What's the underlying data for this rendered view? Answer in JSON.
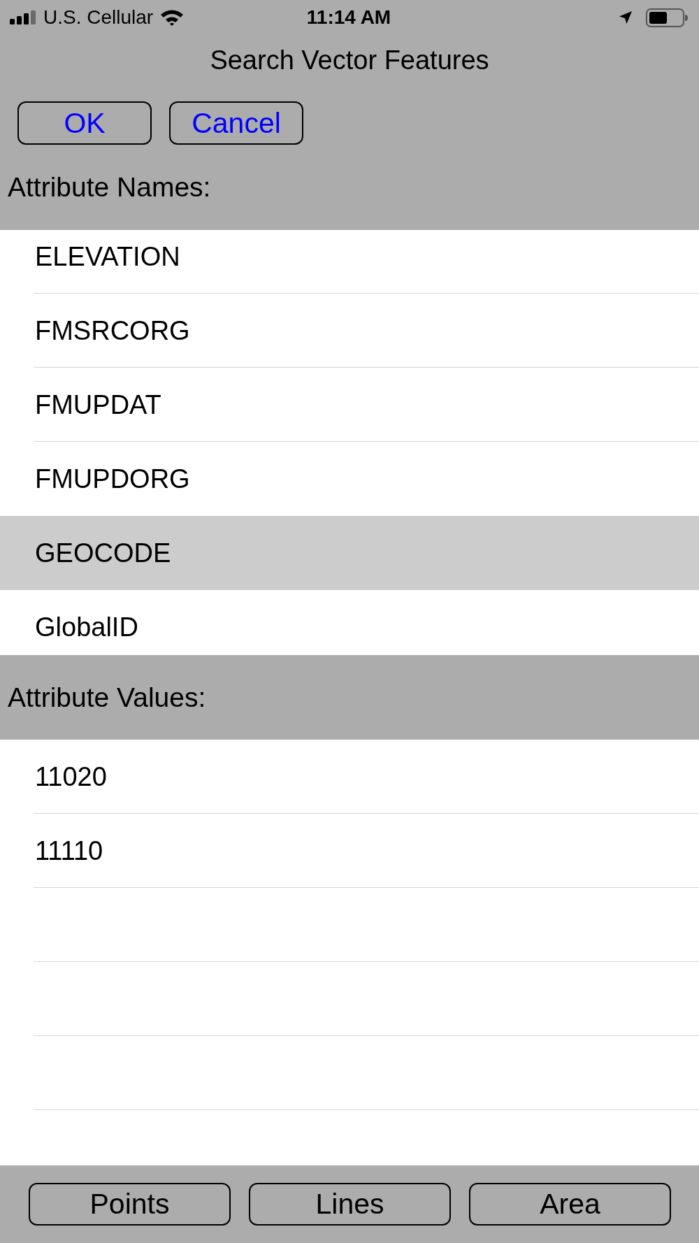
{
  "status_bar": {
    "carrier": "U.S. Cellular",
    "time": "11:14 AM"
  },
  "title": "Search Vector Features",
  "actions": [
    {
      "label": "OK"
    },
    {
      "label": "Cancel"
    }
  ],
  "attribute_names": {
    "heading": "Attribute Names:",
    "items": [
      {
        "label": "ELEVATION",
        "selected": false
      },
      {
        "label": "FMSRCORG",
        "selected": false
      },
      {
        "label": "FMUPDAT",
        "selected": false
      },
      {
        "label": "FMUPDORG",
        "selected": false
      },
      {
        "label": "GEOCODE",
        "selected": true
      },
      {
        "label": "GlobalID",
        "selected": false
      }
    ]
  },
  "attribute_values": {
    "heading": "Attribute Values:",
    "items": [
      {
        "label": "11020",
        "selected": false
      },
      {
        "label": "11110",
        "selected": false
      }
    ]
  },
  "toolbar": [
    {
      "label": "Points"
    },
    {
      "label": "Lines"
    },
    {
      "label": "Area"
    }
  ]
}
